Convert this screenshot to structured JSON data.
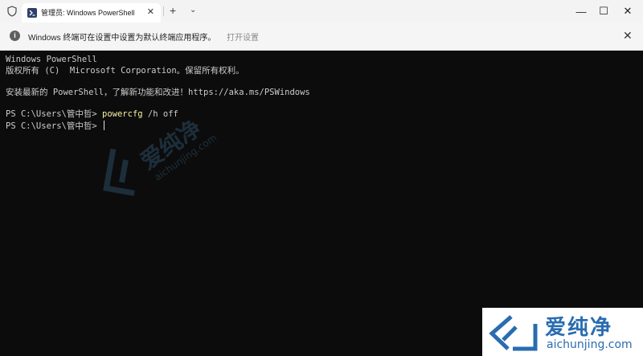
{
  "window": {
    "tab_title": "管理员: Windows PowerShell",
    "tab_close": "✕",
    "new_tab": "+",
    "dropdown": "⌄",
    "minimize": "—",
    "maximize": "☐",
    "close": "✕"
  },
  "infobar": {
    "icon": "i",
    "message": "Windows 终端可在设置中设置为默认终端应用程序。",
    "link": "打开设置",
    "close": "✕"
  },
  "terminal": {
    "lines": [
      "Windows PowerShell",
      "版权所有 (C)  Microsoft Corporation。保留所有权利。",
      "",
      "安装最新的 PowerShell，了解新功能和改进！https://aka.ms/PSWindows",
      ""
    ],
    "prompt1": "PS C:\\Users\\管中哲> ",
    "command": "powercfg",
    "command_args": " /h off",
    "prompt2": "PS C:\\Users\\管中哲> "
  },
  "watermark": {
    "brand": "爱纯净",
    "url": "aichunjing.com"
  },
  "colors": {
    "terminal_bg": "#0c0c0c",
    "command": "#f9f1a5",
    "brand": "#2a6cb0"
  }
}
